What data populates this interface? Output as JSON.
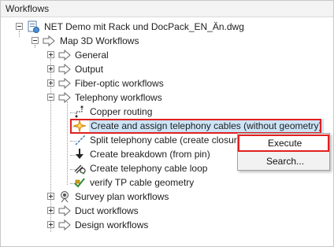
{
  "panel": {
    "title": "Workflows"
  },
  "tree": {
    "root": "NET Demo mit Rack und DocPack_EN_Än.dwg",
    "map3d": "Map 3D Workflows",
    "general": "General",
    "output": "Output",
    "fiber": "Fiber-optic workflows",
    "telephony": "Telephony workflows",
    "telephony_children": {
      "copper": "Copper routing",
      "create_assign": "Create and assign telephony cables (without geometry)",
      "split": "Split telephony cable (create closure)",
      "breakdown": "Create breakdown (from pin)",
      "loop": "Create telephony cable loop",
      "verify": "verify TP cable geometry"
    },
    "survey": "Survey plan workflows",
    "duct": "Duct workflows",
    "design": "Design workflows"
  },
  "context_menu": {
    "items": [
      "Execute",
      "Search..."
    ]
  },
  "colors": {
    "highlight": "#e02020",
    "selection": "#cce4f7",
    "arrow": "#6a6a6a"
  }
}
